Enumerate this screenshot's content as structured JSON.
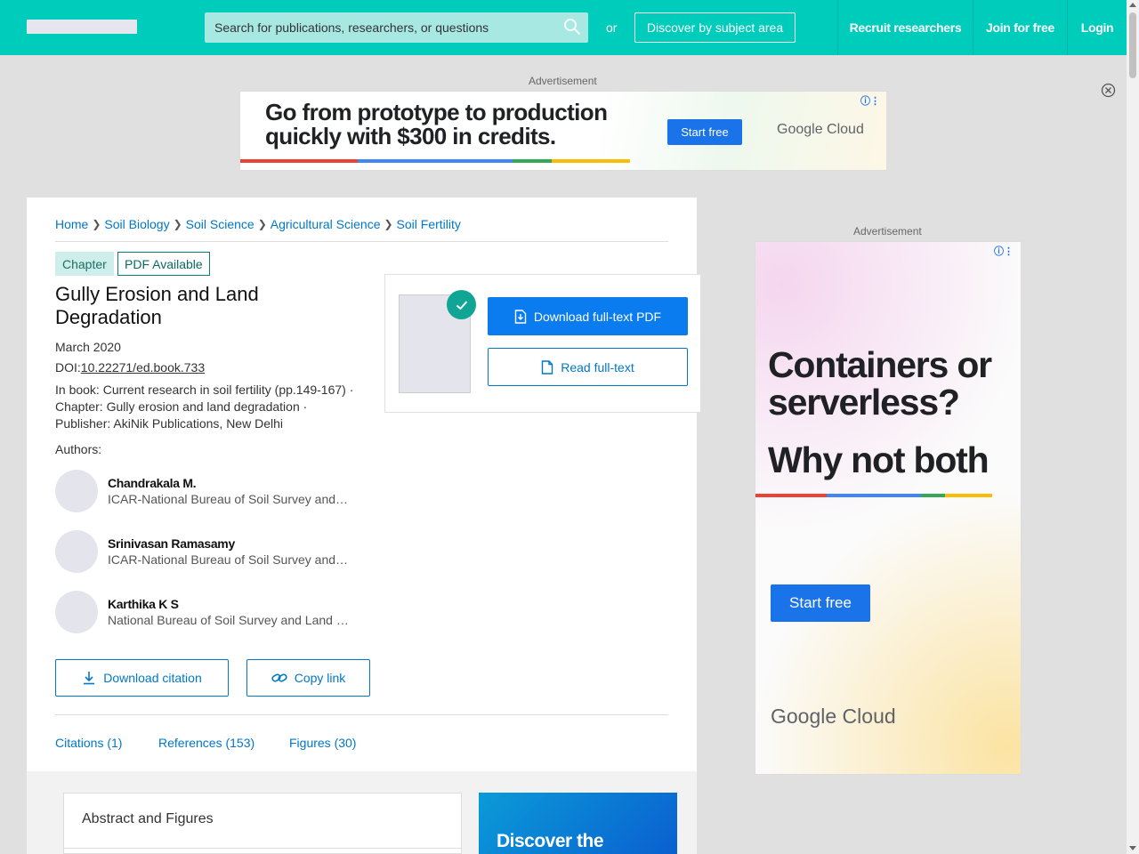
{
  "header": {
    "search_placeholder": "Search for publications, researchers, or questions",
    "or_text": "or",
    "discover_label": "Discover by subject area",
    "recruit_label": "Recruit researchers",
    "join_label": "Join for free",
    "login_label": "Login",
    "accent_color": "#00ccbb"
  },
  "ads": {
    "label": "Advertisement",
    "top": {
      "headline": "Go from prototype to production quickly with $300 in credits.",
      "cta": "Start free",
      "brand": "Google Cloud"
    },
    "side": {
      "headline1": "Containers or serverless?",
      "headline2": "Why not both",
      "cta": "Start free",
      "brand": "Google Cloud"
    }
  },
  "breadcrumb": [
    "Home",
    "Soil Biology",
    "Soil Science",
    "Agricultural Science",
    "Soil Fertility"
  ],
  "publication": {
    "type_badge": "Chapter",
    "pdf_badge": "PDF Available",
    "title": "Gully Erosion and Land Degradation",
    "date": "March 2020",
    "doi_label": "DOI:",
    "doi": "10.22271/ed.book.733",
    "book_line": "In book: Current research in soil fertility (pp.149-167) ·",
    "chapter_line": "Chapter: Gully erosion and land degradation ·",
    "publisher_line": "Publisher: AkiNik Publications, New Delhi",
    "authors_label": "Authors:",
    "authors": [
      {
        "name": "Chandrakala M.",
        "affiliation": "ICAR-National Bureau of Soil Survey and Land Use Planning"
      },
      {
        "name": "Srinivasan Ramasamy",
        "affiliation": "ICAR-National Bureau of Soil Survey and Land Use Planning"
      },
      {
        "name": "Karthika K S",
        "affiliation": "National Bureau of Soil Survey and Land Use Planning"
      }
    ]
  },
  "actions": {
    "download_citation": "Download citation",
    "copy_link": "Copy link",
    "download_pdf": "Download full-text PDF",
    "read_fulltext": "Read full-text"
  },
  "tabs": {
    "citations": "Citations (1)",
    "references": "References (153)",
    "figures": "Figures (30)"
  },
  "abstract_label": "Abstract and Figures",
  "promo_text": "Discover the"
}
